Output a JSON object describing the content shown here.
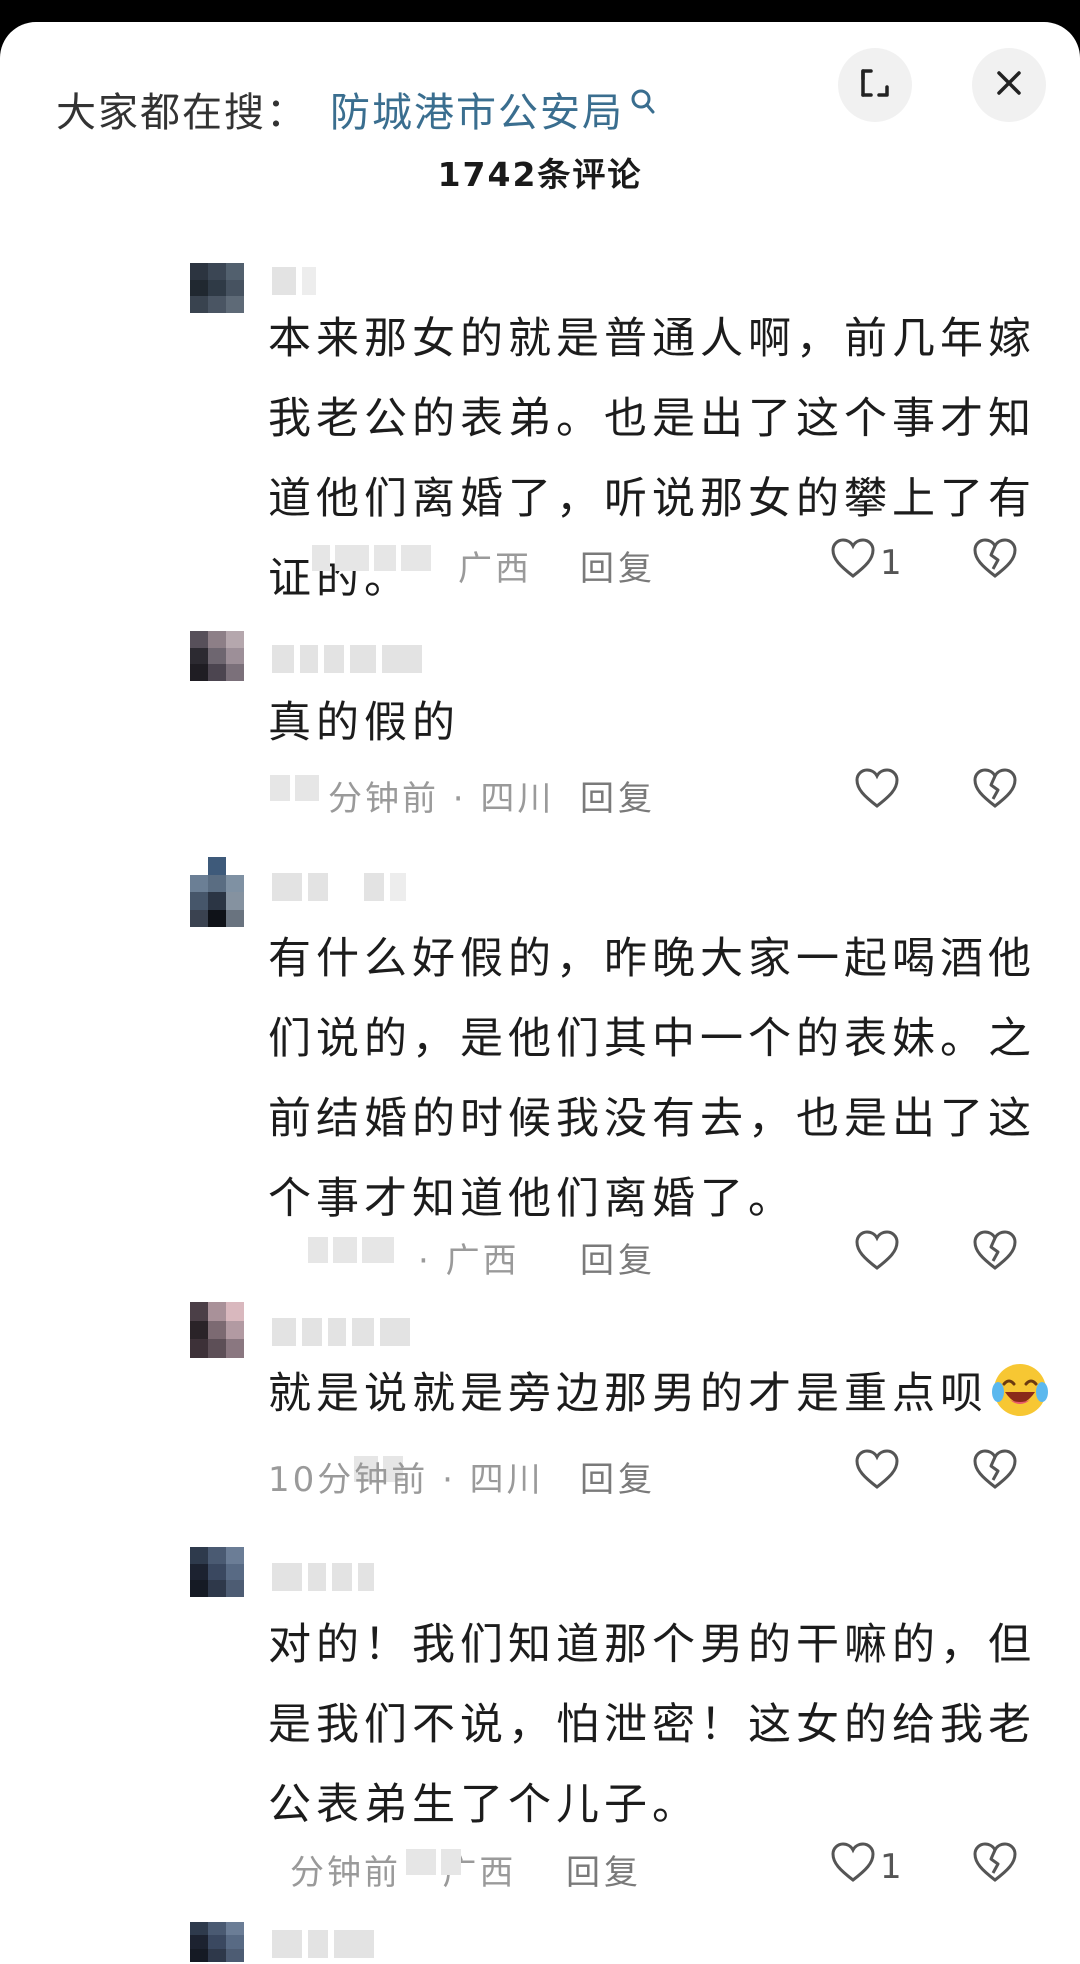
{
  "header": {
    "search_prefix": "大家都在搜：",
    "search_term": "防城港市公安局",
    "comment_count_title": "1742条评论"
  },
  "comments": [
    {
      "text": "本来那女的就是普通人啊，前几年嫁我老公的表弟。也是出了这个事才知道他们离婚了，听说那女的攀上了有证的。",
      "meta": "广西",
      "reply_label": "回复",
      "like_count": "1"
    },
    {
      "text": "真的假的",
      "meta": "分钟前 · 四川",
      "reply_label": "回复",
      "like_count": ""
    },
    {
      "text": "有什么好假的，昨晚大家一起喝酒他们说的，是他们其中一个的表妹。之前结婚的时候我没有去，也是出了这个事才知道他们离婚了。",
      "meta": "· 广西",
      "reply_label": "回复",
      "like_count": ""
    },
    {
      "text": "就是说就是旁边那男的才是重点呗",
      "meta": "10分钟前 · 四川",
      "reply_label": "回复",
      "like_count": ""
    },
    {
      "text": "对的！我们知道那个男的干嘛的，但是我们不说，怕泄密！这女的给我老公表弟生了个儿子。",
      "meta": "分钟前 · 广西",
      "reply_label": "回复",
      "like_count": "1"
    }
  ],
  "icons": {
    "search": "search-icon",
    "expand": "expand-icon",
    "close": "close-icon",
    "like": "heart-icon",
    "dislike": "broken-heart-icon",
    "emoji": "laughing-crying-emoji"
  },
  "colors": {
    "search_term": "#3a6e8f",
    "background": "#ffffff",
    "meta_text": "#9a9a9a"
  }
}
